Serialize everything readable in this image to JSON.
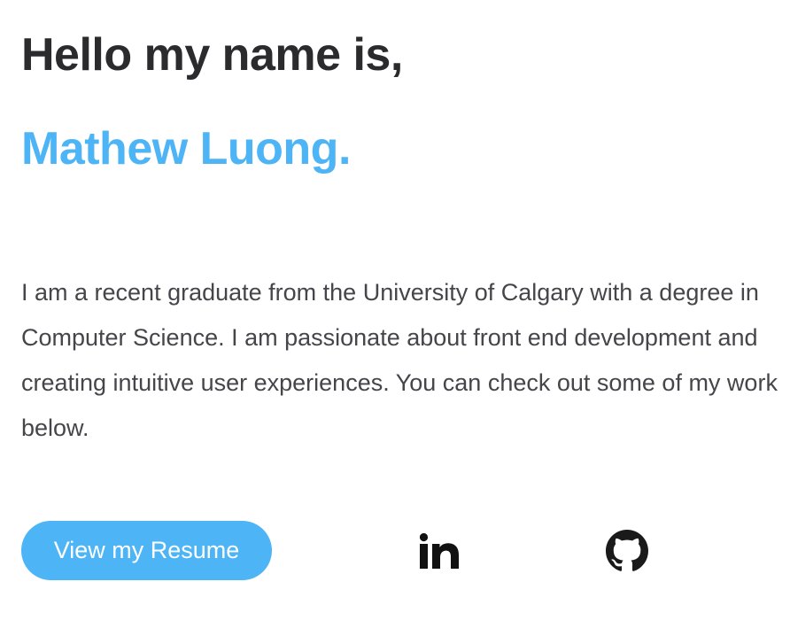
{
  "hero": {
    "greeting": "Hello my name is,",
    "name": "Mathew Luong.",
    "bio": "I am a recent graduate from the University of Calgary with a degree in Computer Science. I am passionate about front end development and creating intuitive user experiences. You can check out some of my work below."
  },
  "actions": {
    "resume_label": "View my Resume",
    "social": [
      {
        "icon": "linkedin-icon"
      },
      {
        "icon": "github-icon"
      }
    ]
  },
  "colors": {
    "accent": "#4db4f5",
    "heading": "#2b2b2e",
    "body_text": "#45454a",
    "background": "#ffffff"
  }
}
